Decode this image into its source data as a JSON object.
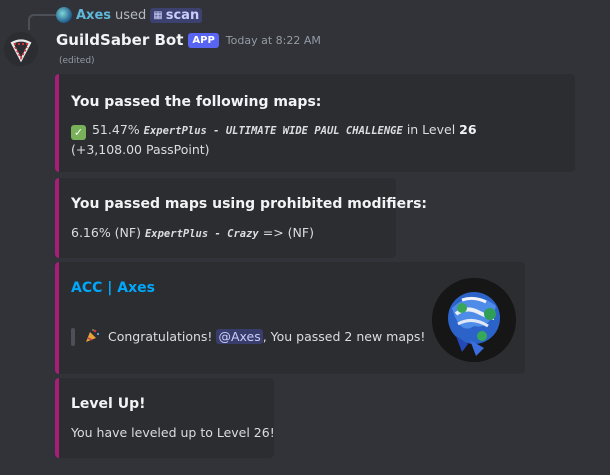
{
  "reply": {
    "user": "Axes",
    "used": "used",
    "command": "scan"
  },
  "message": {
    "bot_name": "GuildSaber Bot",
    "badge": "APP",
    "timestamp": "Today at 8:22 AM",
    "edited": "(edited)"
  },
  "embeds": [
    {
      "title": "You passed the following maps:",
      "line1_percent": "51.47%",
      "line1_map": "ExpertPlus - ULTIMATE WIDE PAUL CHALLENGE",
      "line1_in": "in Level",
      "line1_level": "26",
      "line2": "(+3,108.00 PassPoint)"
    },
    {
      "title": "You passed maps using prohibited modifiers:",
      "line_pre": "6.16% (NF)",
      "line_map": "ExpertPlus - Crazy",
      "line_post": "=> (NF)"
    },
    {
      "title": "ACC | Axes",
      "text_pre": "Congratulations!",
      "mention": "@Axes",
      "text_post": ", You passed 2 new maps!"
    },
    {
      "title": "Level Up!",
      "text": "You have leveled up to Level 26!"
    }
  ],
  "colors": {
    "embed_border": "#a71e76",
    "link": "#00a8fc",
    "badge": "#5865f2"
  },
  "icons": {
    "command": "slash-command-icon",
    "check": "check-mark-icon",
    "party": "party-popper-icon"
  }
}
